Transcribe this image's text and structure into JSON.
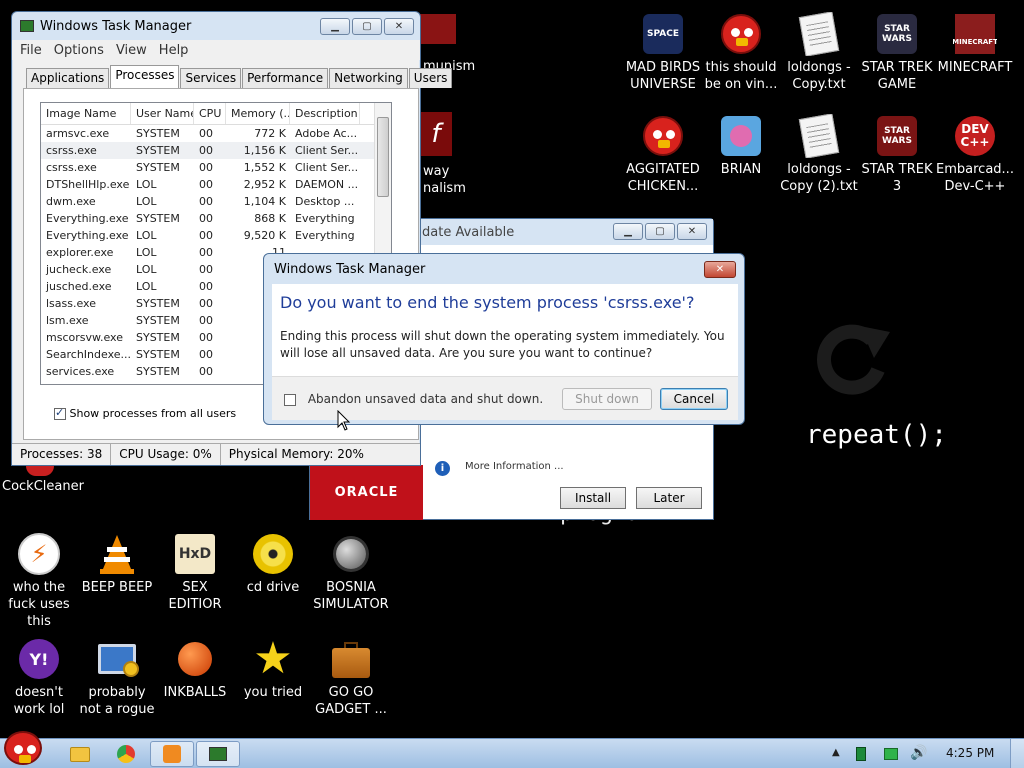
{
  "desktop_icons": {
    "mad_birds": "MAD BIRDS UNIVERSE",
    "this_should": "this should be on vin...",
    "loldongs_copy": "loldongs - Copy.txt",
    "star_trek_game": "STAR TREK GAME",
    "minecraft": "MINECRAFT",
    "agitated_chicken": "AGGITATED CHICKEN...",
    "brian": "BRIAN",
    "loldongs_copy2": "loldongs - Copy (2).txt",
    "star_trek3": "STAR TREK 3",
    "embarcadero": "Embarcad... Dev-C++",
    "communism_partial": "munism",
    "flash_line1": "way",
    "flash_line2": "nalism",
    "cockcleaner": "CockCleaner",
    "who_the_fuck": "who the fuck uses this",
    "beep_beep": "BEEP BEEP",
    "sex_editior": "SEX EDITIOR",
    "cd_drive": "cd drive",
    "bosnia": "BOSNIA SIMULATOR",
    "doesnt_work": "doesn't work lol",
    "probably_not_rogue": "probably not a rogue",
    "inkballs": "INKBALLS",
    "you_tried": "you tried",
    "go_go_gadget": "GO GO GADGET ...",
    "repeat_text": "repeat();",
    "prog_partial": "progra...",
    "minecraft_badge": "MINECRAFT",
    "star_badge": "STAR",
    "wars_badge": "WARS",
    "dev_badge": "DEV",
    "cpp_badge": "C++",
    "space_badge": "SPACE",
    "hxd_badge": "HxD",
    "yahoo_badge": "Y!"
  },
  "taskmgr": {
    "title": "Windows Task Manager",
    "menu": [
      "File",
      "Options",
      "View",
      "Help"
    ],
    "tabs": [
      "Applications",
      "Processes",
      "Services",
      "Performance",
      "Networking",
      "Users"
    ],
    "active_tab": "Processes",
    "columns": [
      "Image Name",
      "User Name",
      "CPU",
      "Memory (...",
      "Description"
    ],
    "rows": [
      [
        "armsvc.exe",
        "SYSTEM",
        "00",
        "772 K",
        "Adobe Ac..."
      ],
      [
        "csrss.exe",
        "SYSTEM",
        "00",
        "1,156 K",
        "Client Ser..."
      ],
      [
        "csrss.exe",
        "SYSTEM",
        "00",
        "1,552 K",
        "Client Ser..."
      ],
      [
        "DTShellHlp.exe",
        "LOL",
        "00",
        "2,952 K",
        "DAEMON ..."
      ],
      [
        "dwm.exe",
        "LOL",
        "00",
        "1,104 K",
        "Desktop ..."
      ],
      [
        "Everything.exe",
        "SYSTEM",
        "00",
        "868 K",
        "Everything"
      ],
      [
        "Everything.exe",
        "LOL",
        "00",
        "9,520 K",
        "Everything"
      ],
      [
        "explorer.exe",
        "LOL",
        "00",
        "11",
        ""
      ],
      [
        "jucheck.exe",
        "LOL",
        "00",
        "1",
        ""
      ],
      [
        "jusched.exe",
        "LOL",
        "00",
        "2",
        ""
      ],
      [
        "lsass.exe",
        "SYSTEM",
        "00",
        "2",
        ""
      ],
      [
        "lsm.exe",
        "SYSTEM",
        "00",
        "",
        ""
      ],
      [
        "mscorsvw.exe",
        "SYSTEM",
        "00",
        "1",
        ""
      ],
      [
        "SearchIndexe...",
        "SYSTEM",
        "00",
        "4",
        ""
      ],
      [
        "services.exe",
        "SYSTEM",
        "00",
        "2",
        ""
      ]
    ],
    "show_all_label": "Show processes from all users",
    "status": {
      "processes": "Processes: 38",
      "cpu": "CPU Usage: 0%",
      "memory": "Physical Memory: 20%"
    }
  },
  "java_update": {
    "title_partial": "date Available",
    "more_info": "More Information ...",
    "install": "Install",
    "later": "Later",
    "oracle": "ORACLE"
  },
  "dialog": {
    "title": "Windows Task Manager",
    "heading": "Do you want to end the system process 'csrss.exe'?",
    "body": "Ending this process will shut down the operating system immediately.  You will lose all unsaved data.  Are you sure you want to continue?",
    "checkbox_label": "Abandon unsaved data and shut down.",
    "shutdown_button": "Shut down",
    "cancel_button": "Cancel"
  },
  "taskbar": {
    "clock": "4:25 PM"
  },
  "colors": {
    "desktop_bg": "#000000",
    "heading_blue": "#1f3d99",
    "oracle_red": "#c0111a"
  }
}
